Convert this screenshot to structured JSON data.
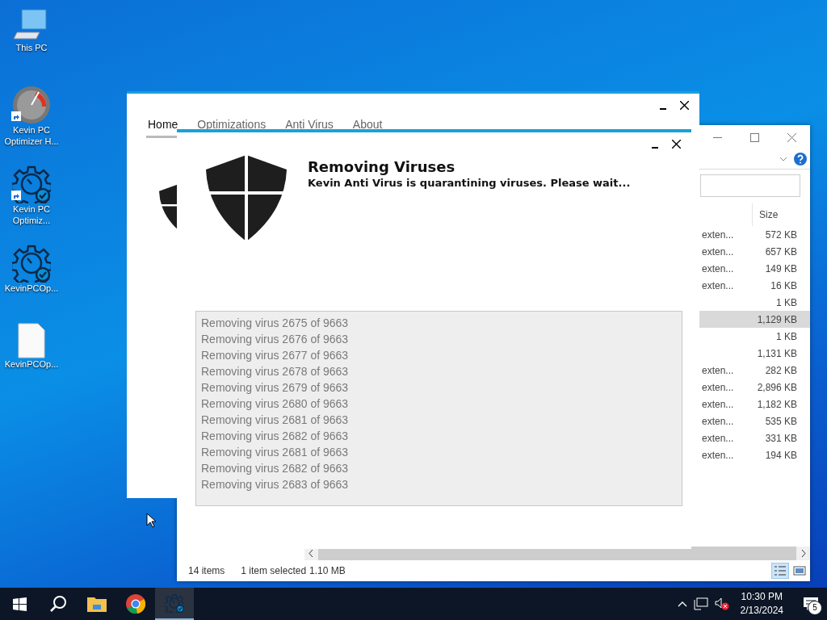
{
  "desktop_icons": [
    {
      "kind": "computer",
      "label": "This PC",
      "shortcut": false
    },
    {
      "kind": "gauge",
      "label": "Kevin PC Optimizer H...",
      "shortcut": true
    },
    {
      "kind": "gear",
      "label": "Kevin PC Optimiz...",
      "shortcut": true
    },
    {
      "kind": "gear",
      "label": "KevinPCOp...",
      "shortcut": false
    },
    {
      "kind": "file",
      "label": "KevinPCOp...",
      "shortcut": false
    }
  ],
  "explorer": {
    "column_header": "Size",
    "rows": [
      {
        "type": "exten...",
        "size": "572 KB",
        "selected": false
      },
      {
        "type": "exten...",
        "size": "657 KB",
        "selected": false
      },
      {
        "type": "exten...",
        "size": "149 KB",
        "selected": false
      },
      {
        "type": "exten...",
        "size": "16 KB",
        "selected": false
      },
      {
        "size": "1 KB",
        "selected": false
      },
      {
        "size": "1,129 KB",
        "selected": true
      },
      {
        "size": "1 KB",
        "selected": false
      },
      {
        "size": "1,131 KB",
        "selected": false
      },
      {
        "type": "exten...",
        "size": "282 KB",
        "selected": false
      },
      {
        "type": "exten...",
        "size": "2,896 KB",
        "selected": false
      },
      {
        "type": "exten...",
        "size": "1,182 KB",
        "selected": false
      },
      {
        "type": "exten...",
        "size": "535 KB",
        "selected": false
      },
      {
        "type": "exten...",
        "size": "331 KB",
        "selected": false
      },
      {
        "type": "exten...",
        "size": "194 KB",
        "selected": false
      }
    ],
    "status_bar": {
      "item_count": "14 items",
      "selection": "1 item selected",
      "selection_size": "1.10 MB"
    }
  },
  "app_window": {
    "tabs": [
      {
        "label": "Home",
        "selected": true
      },
      {
        "label": "Optimizations",
        "selected": false
      },
      {
        "label": "Anti Virus",
        "selected": false
      },
      {
        "label": "About",
        "selected": false
      }
    ]
  },
  "dialog": {
    "title": "Removing Viruses",
    "message": "Kevin Anti Virus is quarantining viruses. Please wait...",
    "log": [
      "Removing virus 2675 of 9663",
      "Removing virus 2676 of 9663",
      "Removing virus 2677 of 9663",
      "Removing virus 2678 of 9663",
      "Removing virus 2679 of 9663",
      "Removing virus 2680 of 9663",
      "Removing virus 2681 of 9663",
      "Removing virus 2682 of 9663",
      "Removing virus 2681 of 9663",
      "Removing virus 2682 of 9663",
      "Removing virus 2683 of 9663"
    ]
  },
  "taskbar": {
    "apps": [
      {
        "kind": "folder",
        "active": false
      },
      {
        "kind": "browser",
        "active": false
      },
      {
        "kind": "gear",
        "active": true
      }
    ],
    "time": "10:30 PM",
    "date": "2/13/2024",
    "notification_count": "5"
  }
}
